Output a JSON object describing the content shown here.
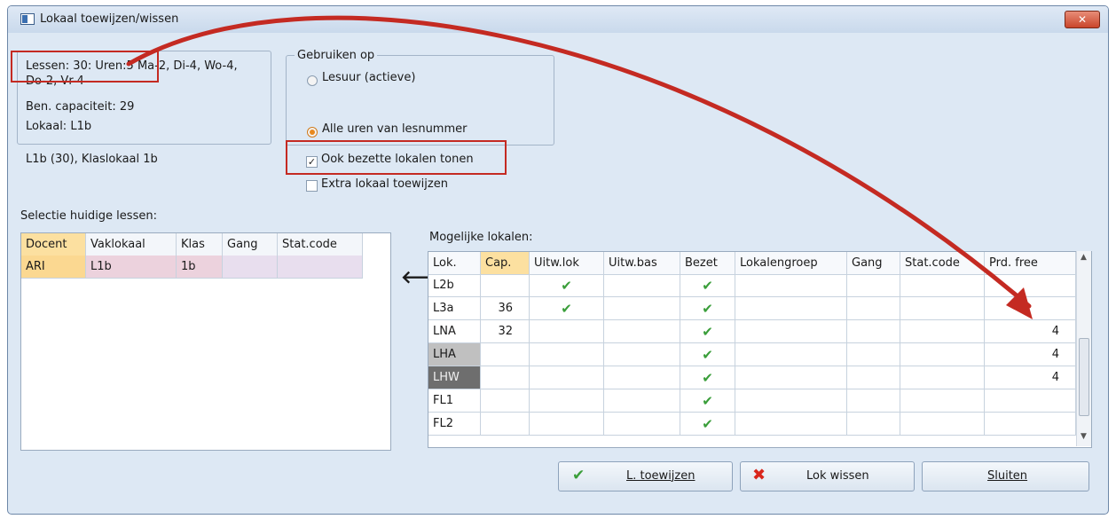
{
  "window": {
    "title": "Lokaal toewijzen/wissen",
    "close_label": "✕"
  },
  "info": {
    "lessen_line1": "Lessen: 30: Uren:5 Ma-2, Di-4, Wo-4,",
    "lessen_line2": "Do-2, Vr-4",
    "capaciteit": "Ben. capaciteit: 29",
    "lokaal": "Lokaal: L1b",
    "lokaal_desc": "L1b (30), Klaslokaal 1b"
  },
  "gebruiken_op": {
    "legend": "Gebruiken op",
    "option_lesuur": "Lesuur (actieve)",
    "option_alle": "Alle uren van lesnummer",
    "selected": "option_alle"
  },
  "options": {
    "ook_bezette": {
      "label": "Ook bezette lokalen tonen",
      "checked": true
    },
    "extra_lokaal": {
      "label": "Extra lokaal toewijzen",
      "checked": false
    }
  },
  "selectie": {
    "caption": "Selectie huidige lessen:",
    "columns": [
      "Docent",
      "Vaklokaal",
      "Klas",
      "Gang",
      "Stat.code"
    ],
    "rows": [
      [
        "ARI",
        "L1b",
        "1b",
        "",
        ""
      ]
    ]
  },
  "mogelijke": {
    "caption": "Mogelijke lokalen:",
    "columns": [
      "Lok.",
      "Cap.",
      "Uitw.lok",
      "Uitw.bas",
      "Bezet",
      "Lokalengroep",
      "Gang",
      "Stat.code",
      "Prd. free"
    ],
    "rows": [
      [
        "L2b",
        "",
        "✔",
        "",
        "✔",
        "",
        "",
        "",
        ""
      ],
      [
        "L3a",
        "36",
        "✔",
        "",
        "✔",
        "",
        "",
        "",
        ""
      ],
      [
        "LNA",
        "32",
        "",
        "",
        "✔",
        "",
        "",
        "",
        "4"
      ],
      [
        "LHA",
        "",
        "",
        "",
        "✔",
        "",
        "",
        "",
        "4"
      ],
      [
        "LHW",
        "",
        "",
        "",
        "✔",
        "",
        "",
        "",
        "4"
      ],
      [
        "FL1",
        "",
        "",
        "",
        "✔",
        "",
        "",
        "",
        ""
      ],
      [
        "FL2",
        "",
        "",
        "",
        "✔",
        "",
        "",
        "",
        ""
      ]
    ]
  },
  "transfer_arrow": "🡐",
  "buttons": {
    "toewijzen": "L. toewijzen",
    "wissen": "Lok wissen",
    "sluiten": "Sluiten"
  },
  "colors": {
    "annotation_red": "#c42a22",
    "check_green": "#3a9e3a",
    "cancel_red": "#d9261c",
    "cap_header_bg": "#fce0a0"
  }
}
